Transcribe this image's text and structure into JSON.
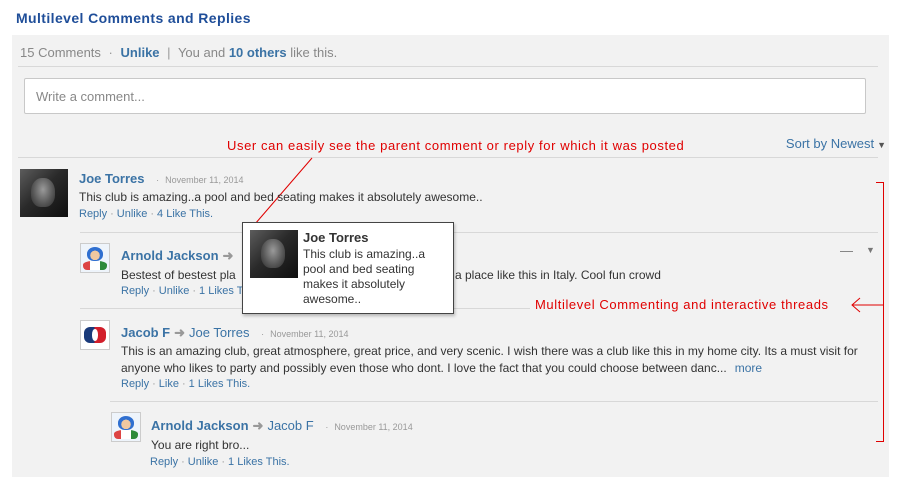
{
  "page_title": "Multilevel Comments and Replies",
  "summary": {
    "comments_count": "15 Comments",
    "unlike": "Unlike",
    "you_and": "You and",
    "others": "10 others",
    "like_this": "like this."
  },
  "comment_input": {
    "placeholder": "Write a comment..."
  },
  "sort": {
    "label": "Sort by Newest"
  },
  "annotations": {
    "parent_hint": "User can easily see the parent comment or reply for which it was posted",
    "multilevel_hint": "Multilevel Commenting and interactive threads"
  },
  "comments": [
    {
      "author": "Joe Torres",
      "date": "November 11, 2014",
      "text": "This club is amazing..a pool and bed seating makes it absolutely awesome..",
      "actions": [
        "Reply",
        "Unlike",
        "4 Like This."
      ]
    },
    {
      "author": "Arnold Jackson",
      "text_before": "Bestest of bestest pla",
      "text_after": "a place like this in Italy. Cool fun crowd",
      "actions": [
        "Reply",
        "Unlike",
        "1 Likes Th"
      ]
    },
    {
      "author": "Jacob F",
      "reply_to": "Joe Torres",
      "date": "November 11, 2014",
      "text": "This is an amazing club, great atmosphere, great price, and very scenic. I wish there was a club like this in my home city. Its a must visit for anyone who likes to party and possibly even those who dont. I love the fact that you could choose between danc...",
      "more": "more",
      "actions": [
        "Reply",
        "Like",
        "1 Likes This."
      ]
    },
    {
      "author": "Arnold Jackson",
      "reply_to": "Jacob F",
      "date": "November 11, 2014",
      "text": "You are right bro...",
      "actions": [
        "Reply",
        "Unlike",
        "1 Likes This."
      ]
    }
  ],
  "tooltip": {
    "author": "Joe Torres",
    "text": "This club is amazing..a pool and bed seating makes it absolutely awesome.."
  },
  "icons": {
    "reply_arrow": "reply-arrow-icon",
    "collapse": "minus-icon",
    "menu": "caret-down-icon"
  },
  "colors": {
    "link": "#3b73a5",
    "title": "#1f4e99",
    "annotation": "#e00000"
  }
}
